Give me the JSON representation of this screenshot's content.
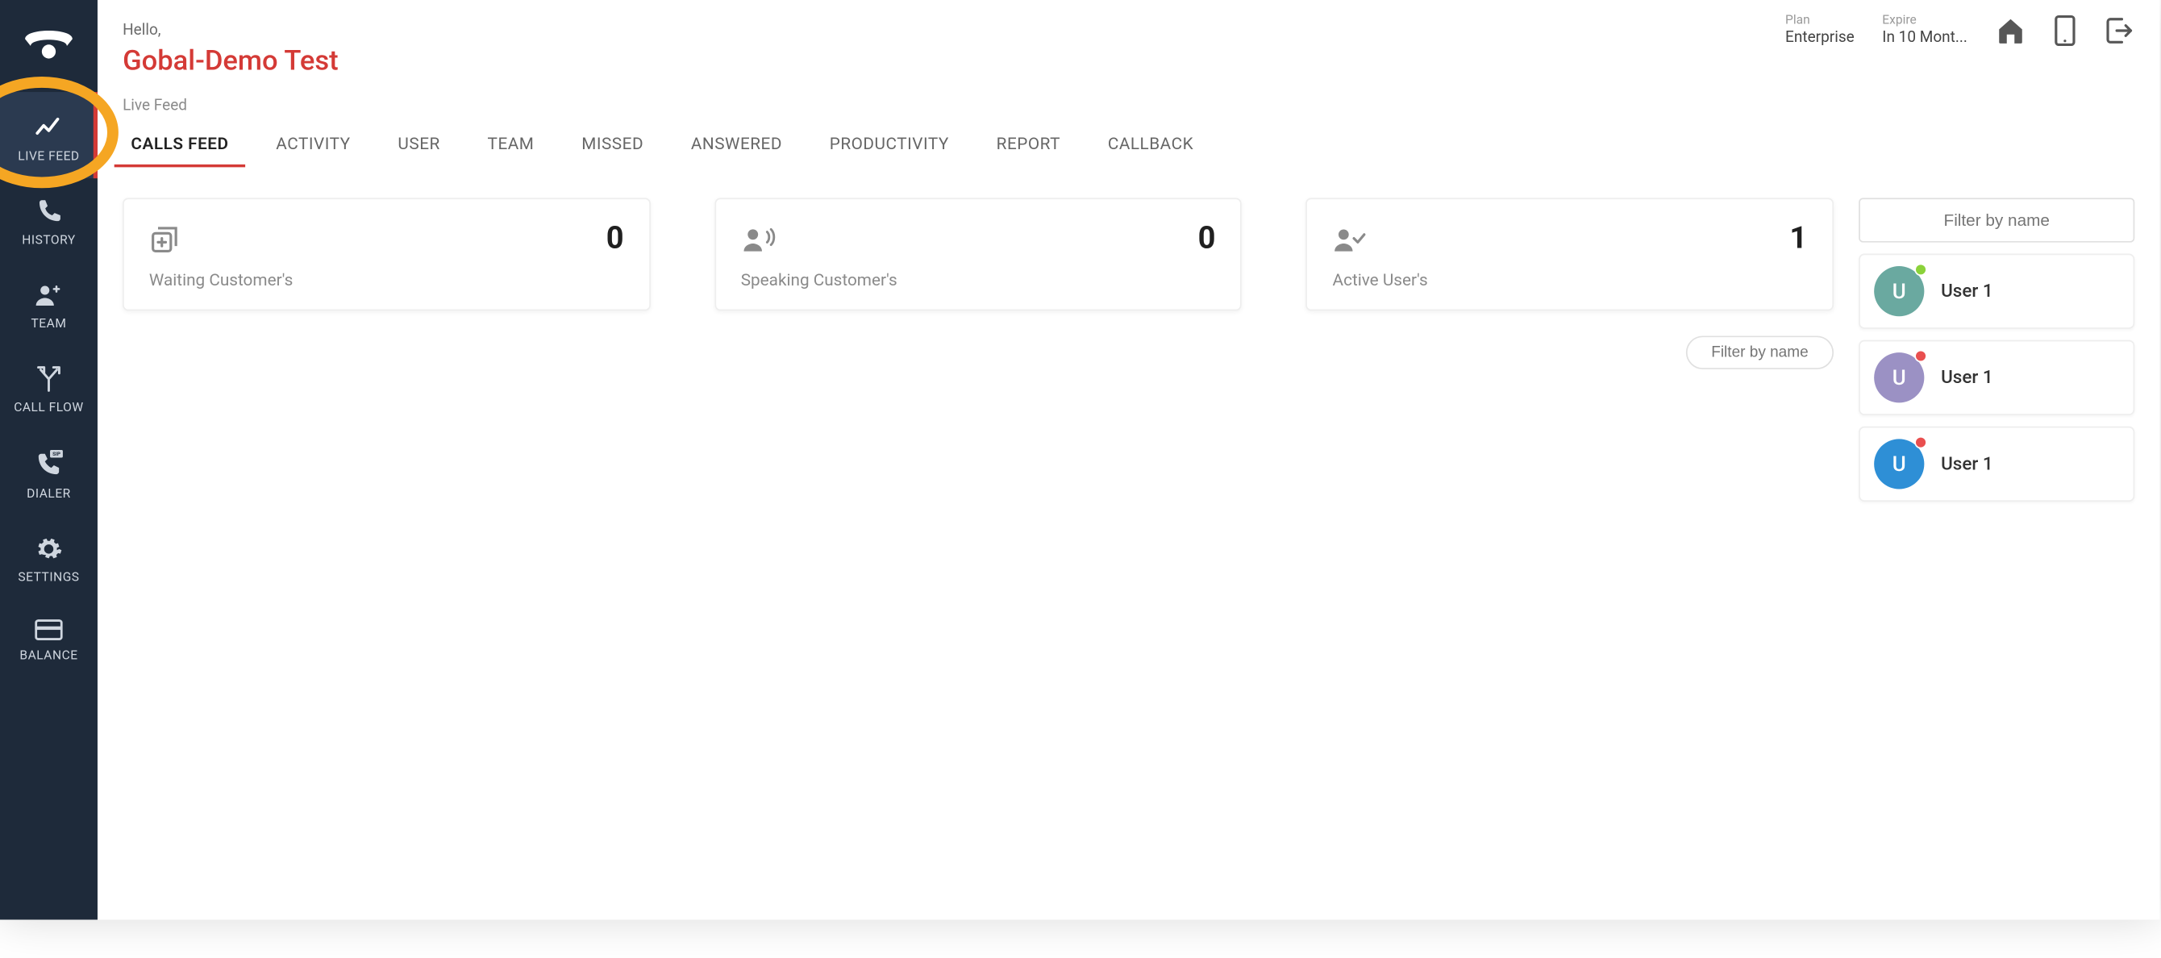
{
  "greeting": {
    "hello": "Hello,",
    "name": "Gobal-Demo Test"
  },
  "plan": {
    "label": "Plan",
    "value": "Enterprise"
  },
  "expire": {
    "label": "Expire",
    "value": "In 10 Mont..."
  },
  "breadcrumb": "Live Feed",
  "tabs": [
    {
      "label": "CALLS FEED"
    },
    {
      "label": "ACTIVITY"
    },
    {
      "label": "USER"
    },
    {
      "label": "TEAM"
    },
    {
      "label": "MISSED"
    },
    {
      "label": "ANSWERED"
    },
    {
      "label": "PRODUCTIVITY"
    },
    {
      "label": "REPORT"
    },
    {
      "label": "CALLBACK"
    }
  ],
  "sidebar": [
    {
      "label": "LIVE FEED"
    },
    {
      "label": "HISTORY"
    },
    {
      "label": "TEAM"
    },
    {
      "label": "CALL FLOW"
    },
    {
      "label": "DIALER"
    },
    {
      "label": "SETTINGS"
    },
    {
      "label": "BALANCE"
    }
  ],
  "cards": [
    {
      "value": "0",
      "label": "Waiting Customer's"
    },
    {
      "value": "0",
      "label": "Speaking Customer's"
    },
    {
      "value": "1",
      "label": "Active User's"
    }
  ],
  "filter_small_placeholder": "Filter by name",
  "filter_box_placeholder": "Filter by name",
  "users": [
    {
      "initial": "U",
      "name": "User 1",
      "color": "#6aa9a0",
      "dot": "#8bd23a"
    },
    {
      "initial": "U",
      "name": "User 1",
      "color": "#9b91c4",
      "dot": "#e94f4f"
    },
    {
      "initial": "U",
      "name": "User 1",
      "color": "#2e8fd6",
      "dot": "#e94f4f"
    }
  ]
}
